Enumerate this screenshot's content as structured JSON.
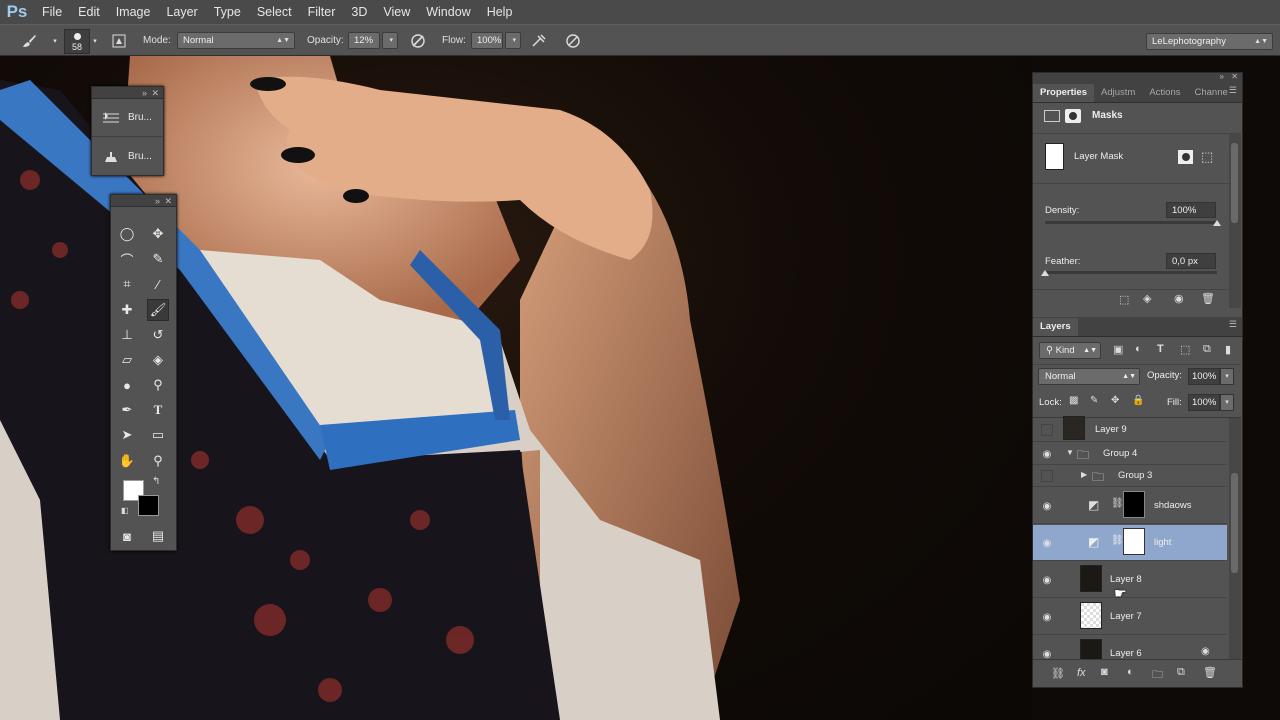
{
  "app": {
    "logo": "Ps"
  },
  "menu": [
    "File",
    "Edit",
    "Image",
    "Layer",
    "Type",
    "Select",
    "Filter",
    "3D",
    "View",
    "Window",
    "Help"
  ],
  "options": {
    "brush_size": "58",
    "mode_label": "Mode:",
    "mode_value": "Normal",
    "opacity_label": "Opacity:",
    "opacity_value": "12%",
    "flow_label": "Flow:",
    "flow_value": "100%",
    "workspace": "LeLephotography"
  },
  "brush_panel": {
    "items": [
      "Bru...",
      "Bru..."
    ]
  },
  "properties": {
    "tabs": [
      "Properties",
      "Adjustm",
      "Actions",
      "Channe"
    ],
    "section": "Masks",
    "mask_label": "Layer Mask",
    "density_label": "Density:",
    "density_value": "100%",
    "density_level": 1.0,
    "feather_label": "Feather:",
    "feather_value": "0,0 px",
    "feather_level": 0.0
  },
  "layers": {
    "tab": "Layers",
    "filter": "Kind",
    "blend": "Normal",
    "opacity_label": "Opacity:",
    "opacity_value": "100%",
    "lock_label": "Lock:",
    "fill_label": "Fill:",
    "fill_value": "100%",
    "rows": [
      {
        "name": "Layer 9",
        "visible": false
      },
      {
        "name": "Group 4",
        "visible": true
      },
      {
        "name": "Group 3",
        "visible": false
      },
      {
        "name": "shdaows",
        "visible": true
      },
      {
        "name": "light",
        "visible": true,
        "selected": true
      },
      {
        "name": "Layer 8",
        "visible": true
      },
      {
        "name": "Layer 7",
        "visible": true
      },
      {
        "name": "Layer 6",
        "visible": true
      }
    ]
  },
  "colors": {
    "accent": "#7a9fd0",
    "panel": "#535353",
    "menubar": "#4a4a4a",
    "selected_row": "#8fa7cc"
  }
}
